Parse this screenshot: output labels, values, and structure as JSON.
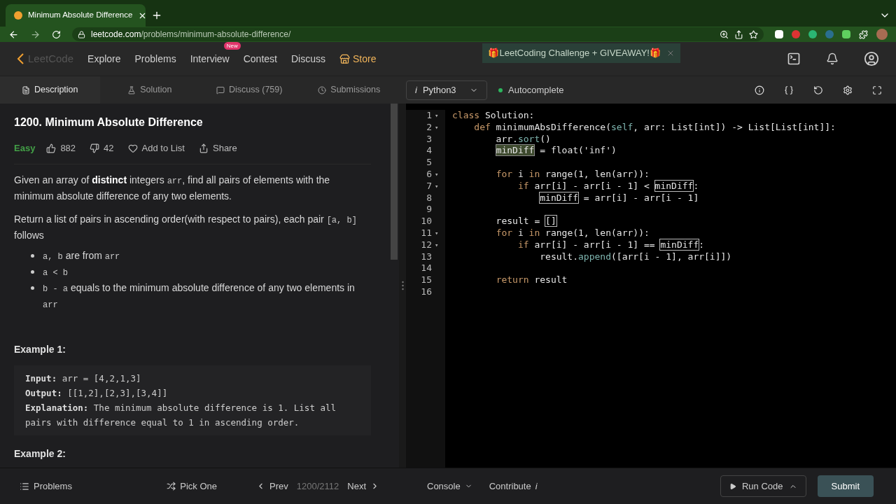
{
  "browser": {
    "tab_title": "Minimum Absolute Difference",
    "url_host": "leetcode.com",
    "url_path": "/problems/minimum-absolute-difference/"
  },
  "nav": {
    "logo": "LeetCode",
    "items": [
      {
        "label": "Explore"
      },
      {
        "label": "Problems"
      },
      {
        "label": "Interview",
        "badge": "New"
      },
      {
        "label": "Contest"
      },
      {
        "label": "Discuss"
      }
    ],
    "store": "Store",
    "banner": "🎁LeetCoding Challenge + GIVEAWAY!🎁"
  },
  "tabs": [
    {
      "label": "Description",
      "selected": true
    },
    {
      "label": "Solution",
      "selected": false
    },
    {
      "label": "Discuss (759)",
      "selected": false
    },
    {
      "label": "Submissions",
      "selected": false
    }
  ],
  "editor_bar": {
    "language_icon": "i",
    "language": "Python3",
    "autocomplete": "Autocomplete",
    "autocomplete_on": true
  },
  "problem": {
    "title": "1200. Minimum Absolute Difference",
    "difficulty": "Easy",
    "likes": "882",
    "dislikes": "42",
    "add_to_list": "Add to List",
    "share": "Share",
    "paragraphs": [
      [
        {
          "kind": "text",
          "t": "Given an array of "
        },
        {
          "kind": "bold",
          "t": "distinct"
        },
        {
          "kind": "text",
          "t": " integers "
        },
        {
          "kind": "code",
          "t": "arr"
        },
        {
          "kind": "text",
          "t": ", find all pairs of elements with the minimum absolute difference of any two elements."
        }
      ],
      [
        {
          "kind": "text",
          "t": "Return a list of pairs in ascending order(with respect to pairs), each pair "
        },
        {
          "kind": "code",
          "t": "[a, b]"
        },
        {
          "kind": "text",
          "t": " follows"
        }
      ]
    ],
    "bullets": [
      [
        {
          "kind": "code",
          "t": "a, b"
        },
        {
          "kind": "text",
          "t": " are from "
        },
        {
          "kind": "code",
          "t": "arr"
        }
      ],
      [
        {
          "kind": "code",
          "t": "a < b"
        }
      ],
      [
        {
          "kind": "code",
          "t": "b - a"
        },
        {
          "kind": "text",
          "t": " equals to the minimum absolute difference of any two elements in "
        },
        {
          "kind": "code",
          "t": "arr"
        }
      ]
    ],
    "example1": {
      "heading": "Example 1:",
      "lines": [
        {
          "label": "Input:",
          "text": " arr = [4,2,1,3]"
        },
        {
          "label": "Output:",
          "text": " [[1,2],[2,3],[3,4]]"
        },
        {
          "label": "Explanation:",
          "text": " The minimum absolute difference is 1. List all pairs with difference equal to 1 in ascending order."
        }
      ]
    },
    "example2_heading": "Example 2:"
  },
  "code": [
    {
      "n": "1",
      "fold": "▾",
      "tokens": [
        {
          "kind": "kw",
          "t": "class"
        },
        {
          "kind": "plain",
          "t": " Solution:"
        }
      ]
    },
    {
      "n": "2",
      "fold": "▾",
      "tokens": [
        {
          "kind": "kw",
          "t": "    def"
        },
        {
          "kind": "plain",
          "t": " minimumAbsDifference("
        },
        {
          "kind": "fn",
          "t": "self"
        },
        {
          "kind": "plain",
          "t": ", arr: List[int]) -> List[List[int]]:"
        }
      ]
    },
    {
      "n": "3",
      "tokens": [
        {
          "kind": "plain",
          "t": "        arr."
        },
        {
          "kind": "fn",
          "t": "sort"
        },
        {
          "kind": "plain",
          "t": "()"
        }
      ]
    },
    {
      "n": "4",
      "tokens": [
        {
          "kind": "sel",
          "t": "        minDiff"
        },
        {
          "kind": "plain",
          "t": " = float('inf')"
        }
      ]
    },
    {
      "n": "5"
    },
    {
      "n": "6",
      "fold": "▾",
      "tokens": [
        {
          "kind": "kw",
          "t": "        for"
        },
        {
          "kind": "plain",
          "t": " i "
        },
        {
          "kind": "kw",
          "t": "in"
        },
        {
          "kind": "plain",
          "t": " range(1, len(arr)):"
        }
      ]
    },
    {
      "n": "7",
      "fold": "▾",
      "tokens": [
        {
          "kind": "kw",
          "t": "            if"
        },
        {
          "kind": "plain",
          "t": " arr[i] - arr[i - 1] < "
        },
        {
          "kind": "box",
          "t": "minDiff"
        },
        {
          "kind": "plain",
          "t": ":"
        }
      ]
    },
    {
      "n": "8",
      "tokens": [
        {
          "kind": "box",
          "t": "                minDiff"
        },
        {
          "kind": "plain",
          "t": " = arr[i] - arr[i - 1]"
        }
      ]
    },
    {
      "n": "9"
    },
    {
      "n": "10",
      "tokens": [
        {
          "kind": "plain",
          "t": "        result = "
        },
        {
          "kind": "box",
          "t": "[]"
        }
      ]
    },
    {
      "n": "11",
      "fold": "▾",
      "tokens": [
        {
          "kind": "kw",
          "t": "        for"
        },
        {
          "kind": "plain",
          "t": " i "
        },
        {
          "kind": "kw",
          "t": "in"
        },
        {
          "kind": "plain",
          "t": " range(1, len(arr)):"
        }
      ]
    },
    {
      "n": "12",
      "fold": "▾",
      "tokens": [
        {
          "kind": "kw",
          "t": "            if"
        },
        {
          "kind": "plain",
          "t": " arr[i] - arr[i - 1] == "
        },
        {
          "kind": "box",
          "t": "minDiff"
        },
        {
          "kind": "plain",
          "t": ":"
        }
      ]
    },
    {
      "n": "13",
      "tokens": [
        {
          "kind": "plain",
          "t": "                result."
        },
        {
          "kind": "fn",
          "t": "append"
        },
        {
          "kind": "plain",
          "t": "([arr[i - 1], arr[i]])"
        }
      ]
    },
    {
      "n": "14"
    },
    {
      "n": "15",
      "tokens": [
        {
          "kind": "kw",
          "t": "        return"
        },
        {
          "kind": "plain",
          "t": " result"
        }
      ]
    },
    {
      "n": "16"
    }
  ],
  "footer": {
    "problems": "Problems",
    "pick_one": "Pick One",
    "prev": "Prev",
    "counter": "1200/2112",
    "next": "Next",
    "console": "Console",
    "contribute": "Contribute",
    "contribute_icon": "i",
    "run_code": "Run Code",
    "submit": "Submit"
  }
}
